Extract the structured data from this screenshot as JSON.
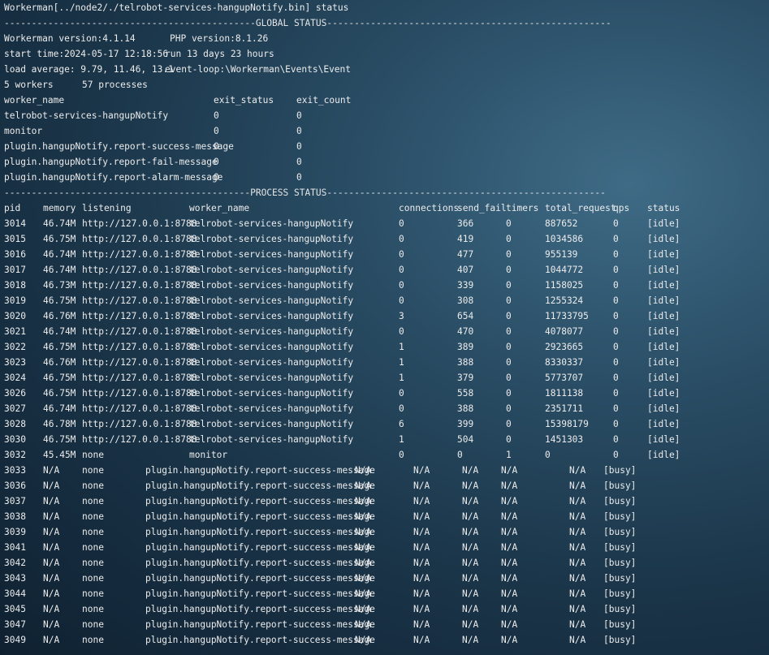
{
  "command_line": "Workerman[../node2/./telrobot-services-hangupNotify.bin] status",
  "global_status_divider": "----------------------------------------------GLOBAL STATUS----------------------------------------------------",
  "workerman_version": "Workerman version:4.1.14",
  "php_version": "PHP version:8.1.26",
  "start_time": "start time:2024-05-17 12:18:56",
  "run_time": "run 13 days 23 hours",
  "load_average": "load average: 9.79, 11.46, 13.1",
  "event_loop": "event-loop:\\Workerman\\Events\\Event",
  "workers_count": "5 workers",
  "processes_count": "57 processes",
  "worker_table": {
    "headers": [
      "worker_name",
      "exit_status",
      "exit_count"
    ],
    "rows": [
      [
        "telrobot-services-hangupNotify",
        "0",
        "0"
      ],
      [
        "monitor",
        "0",
        "0"
      ],
      [
        "plugin.hangupNotify.report-success-message",
        "0",
        "0"
      ],
      [
        "plugin.hangupNotify.report-fail-message",
        "0",
        "0"
      ],
      [
        "plugin.hangupNotify.report-alarm-message",
        "0",
        "0"
      ]
    ]
  },
  "process_status_divider": "---------------------------------------------PROCESS STATUS---------------------------------------------------",
  "process_table": {
    "headers": [
      "pid",
      "memory",
      "listening",
      "worker_name",
      "connections",
      "send_fail",
      "timers",
      "total_request",
      "qps",
      "status"
    ],
    "rows": [
      [
        "3014",
        "46.74M",
        "http://127.0.0.1:8788",
        "telrobot-services-hangupNotify",
        "0",
        "366",
        "0",
        "887652",
        "0",
        "[idle]"
      ],
      [
        "3015",
        "46.75M",
        "http://127.0.0.1:8788",
        "telrobot-services-hangupNotify",
        "0",
        "419",
        "0",
        "1034586",
        "0",
        "[idle]"
      ],
      [
        "3016",
        "46.74M",
        "http://127.0.0.1:8788",
        "telrobot-services-hangupNotify",
        "0",
        "477",
        "0",
        "955139",
        "0",
        "[idle]"
      ],
      [
        "3017",
        "46.74M",
        "http://127.0.0.1:8788",
        "telrobot-services-hangupNotify",
        "0",
        "407",
        "0",
        "1044772",
        "0",
        "[idle]"
      ],
      [
        "3018",
        "46.73M",
        "http://127.0.0.1:8788",
        "telrobot-services-hangupNotify",
        "0",
        "339",
        "0",
        "1158025",
        "0",
        "[idle]"
      ],
      [
        "3019",
        "46.75M",
        "http://127.0.0.1:8788",
        "telrobot-services-hangupNotify",
        "0",
        "308",
        "0",
        "1255324",
        "0",
        "[idle]"
      ],
      [
        "3020",
        "46.76M",
        "http://127.0.0.1:8788",
        "telrobot-services-hangupNotify",
        "3",
        "654",
        "0",
        "11733795",
        "0",
        "[idle]"
      ],
      [
        "3021",
        "46.74M",
        "http://127.0.0.1:8788",
        "telrobot-services-hangupNotify",
        "0",
        "470",
        "0",
        "4078077",
        "0",
        "[idle]"
      ],
      [
        "3022",
        "46.75M",
        "http://127.0.0.1:8788",
        "telrobot-services-hangupNotify",
        "1",
        "389",
        "0",
        "2923665",
        "0",
        "[idle]"
      ],
      [
        "3023",
        "46.76M",
        "http://127.0.0.1:8788",
        "telrobot-services-hangupNotify",
        "1",
        "388",
        "0",
        "8330337",
        "0",
        "[idle]"
      ],
      [
        "3024",
        "46.75M",
        "http://127.0.0.1:8788",
        "telrobot-services-hangupNotify",
        "1",
        "379",
        "0",
        "5773707",
        "0",
        "[idle]"
      ],
      [
        "3026",
        "46.75M",
        "http://127.0.0.1:8788",
        "telrobot-services-hangupNotify",
        "0",
        "558",
        "0",
        "1811138",
        "0",
        "[idle]"
      ],
      [
        "3027",
        "46.74M",
        "http://127.0.0.1:8788",
        "telrobot-services-hangupNotify",
        "0",
        "388",
        "0",
        "2351711",
        "0",
        "[idle]"
      ],
      [
        "3028",
        "46.78M",
        "http://127.0.0.1:8788",
        "telrobot-services-hangupNotify",
        "6",
        "399",
        "0",
        "15398179",
        "0",
        "[idle]"
      ],
      [
        "3030",
        "46.75M",
        "http://127.0.0.1:8788",
        "telrobot-services-hangupNotify",
        "1",
        "504",
        "0",
        "1451303",
        "0",
        "[idle]"
      ],
      [
        "3032",
        "45.45M",
        "none",
        "monitor",
        "0",
        "0",
        "1",
        "0",
        "0",
        "[idle]"
      ]
    ],
    "plugin_rows": [
      [
        "3033",
        "N/A",
        "none",
        "plugin.hangupNotify.report-success-message",
        "N/A",
        "N/A",
        "N/A",
        "N/A",
        "N/A",
        "[busy]"
      ],
      [
        "3036",
        "N/A",
        "none",
        "plugin.hangupNotify.report-success-message",
        "N/A",
        "N/A",
        "N/A",
        "N/A",
        "N/A",
        "[busy]"
      ],
      [
        "3037",
        "N/A",
        "none",
        "plugin.hangupNotify.report-success-message",
        "N/A",
        "N/A",
        "N/A",
        "N/A",
        "N/A",
        "[busy]"
      ],
      [
        "3038",
        "N/A",
        "none",
        "plugin.hangupNotify.report-success-message",
        "N/A",
        "N/A",
        "N/A",
        "N/A",
        "N/A",
        "[busy]"
      ],
      [
        "3039",
        "N/A",
        "none",
        "plugin.hangupNotify.report-success-message",
        "N/A",
        "N/A",
        "N/A",
        "N/A",
        "N/A",
        "[busy]"
      ],
      [
        "3041",
        "N/A",
        "none",
        "plugin.hangupNotify.report-success-message",
        "N/A",
        "N/A",
        "N/A",
        "N/A",
        "N/A",
        "[busy]"
      ],
      [
        "3042",
        "N/A",
        "none",
        "plugin.hangupNotify.report-success-message",
        "N/A",
        "N/A",
        "N/A",
        "N/A",
        "N/A",
        "[busy]"
      ],
      [
        "3043",
        "N/A",
        "none",
        "plugin.hangupNotify.report-success-message",
        "N/A",
        "N/A",
        "N/A",
        "N/A",
        "N/A",
        "[busy]"
      ],
      [
        "3044",
        "N/A",
        "none",
        "plugin.hangupNotify.report-success-message",
        "N/A",
        "N/A",
        "N/A",
        "N/A",
        "N/A",
        "[busy]"
      ],
      [
        "3045",
        "N/A",
        "none",
        "plugin.hangupNotify.report-success-message",
        "N/A",
        "N/A",
        "N/A",
        "N/A",
        "N/A",
        "[busy]"
      ],
      [
        "3047",
        "N/A",
        "none",
        "plugin.hangupNotify.report-success-message",
        "N/A",
        "N/A",
        "N/A",
        "N/A",
        "N/A",
        "[busy]"
      ],
      [
        "3049",
        "N/A",
        "none",
        "plugin.hangupNotify.report-success-message",
        "N/A",
        "N/A",
        "N/A",
        "N/A",
        "N/A",
        "[busy]"
      ]
    ]
  },
  "colors": {
    "text": "#ececec",
    "background_dark": "#0f2131",
    "background_light": "#3f6b86"
  }
}
